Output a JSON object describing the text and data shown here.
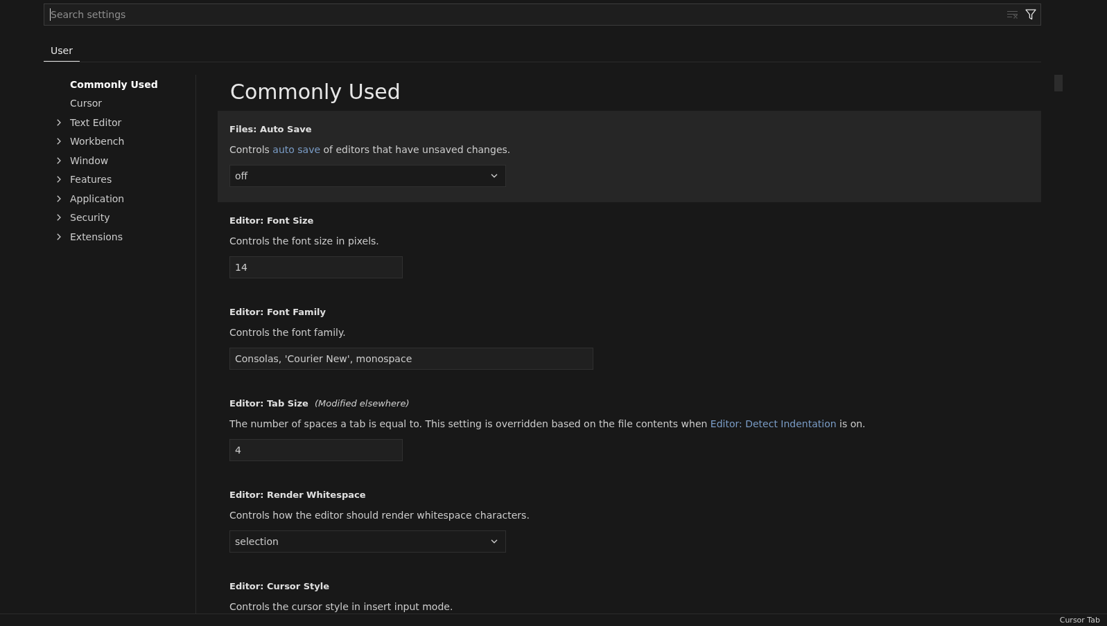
{
  "search": {
    "placeholder": "Search settings",
    "focused": true,
    "actions": [
      {
        "kind": "clear",
        "disabled": true
      },
      {
        "kind": "filter",
        "disabled": false
      }
    ]
  },
  "tabs": [
    {
      "label": "User",
      "selected": true
    }
  ],
  "sidebar": {
    "items": [
      {
        "label": "Commonly Used",
        "kind": "leaf",
        "selected": true
      },
      {
        "label": "Cursor",
        "kind": "leaf",
        "selected": false
      },
      {
        "label": "Text Editor",
        "kind": "group",
        "expanded": false,
        "selected": false
      },
      {
        "label": "Workbench",
        "kind": "group",
        "expanded": false,
        "selected": false
      },
      {
        "label": "Window",
        "kind": "group",
        "expanded": false,
        "selected": false
      },
      {
        "label": "Features",
        "kind": "group",
        "expanded": false,
        "selected": false
      },
      {
        "label": "Application",
        "kind": "group",
        "expanded": false,
        "selected": false
      },
      {
        "label": "Security",
        "kind": "group",
        "expanded": false,
        "selected": false
      },
      {
        "label": "Extensions",
        "kind": "group",
        "expanded": false,
        "selected": false
      }
    ]
  },
  "content": {
    "heading": "Commonly Used",
    "settings": [
      {
        "title": "Files: Auto Save",
        "highlighted": true,
        "description": [
          {
            "kind": "text",
            "text": "Controls "
          },
          {
            "kind": "link",
            "text": "auto save"
          },
          {
            "kind": "text",
            "text": " of editors that have unsaved changes."
          }
        ],
        "control": {
          "kind": "select",
          "value": "off"
        }
      },
      {
        "title": "Editor: Font Size",
        "highlighted": false,
        "description": [
          {
            "kind": "text",
            "text": "Controls the font size in pixels."
          }
        ],
        "control": {
          "kind": "number",
          "value": "14"
        }
      },
      {
        "title": "Editor: Font Family",
        "highlighted": false,
        "description": [
          {
            "kind": "text",
            "text": "Controls the font family."
          }
        ],
        "control": {
          "kind": "text",
          "value": "Consolas, 'Courier New', monospace"
        }
      },
      {
        "title": "Editor: Tab Size",
        "modified_note": "(Modified elsewhere)",
        "highlighted": false,
        "description": [
          {
            "kind": "text",
            "text": "The number of spaces a tab is equal to. This setting is overridden based on the file contents when "
          },
          {
            "kind": "link",
            "text": "Editor: Detect Indentation"
          },
          {
            "kind": "text",
            "text": " is on."
          }
        ],
        "control": {
          "kind": "number",
          "value": "4"
        }
      },
      {
        "title": "Editor: Render Whitespace",
        "highlighted": false,
        "description": [
          {
            "kind": "text",
            "text": "Controls how the editor should render whitespace characters."
          }
        ],
        "control": {
          "kind": "select",
          "value": "selection"
        }
      },
      {
        "title": "Editor: Cursor Style",
        "highlighted": false,
        "description": [
          {
            "kind": "text",
            "text": "Controls the cursor style in insert input mode."
          }
        ]
      }
    ]
  },
  "status_bar": {
    "items": [
      "Cursor Tab"
    ]
  }
}
